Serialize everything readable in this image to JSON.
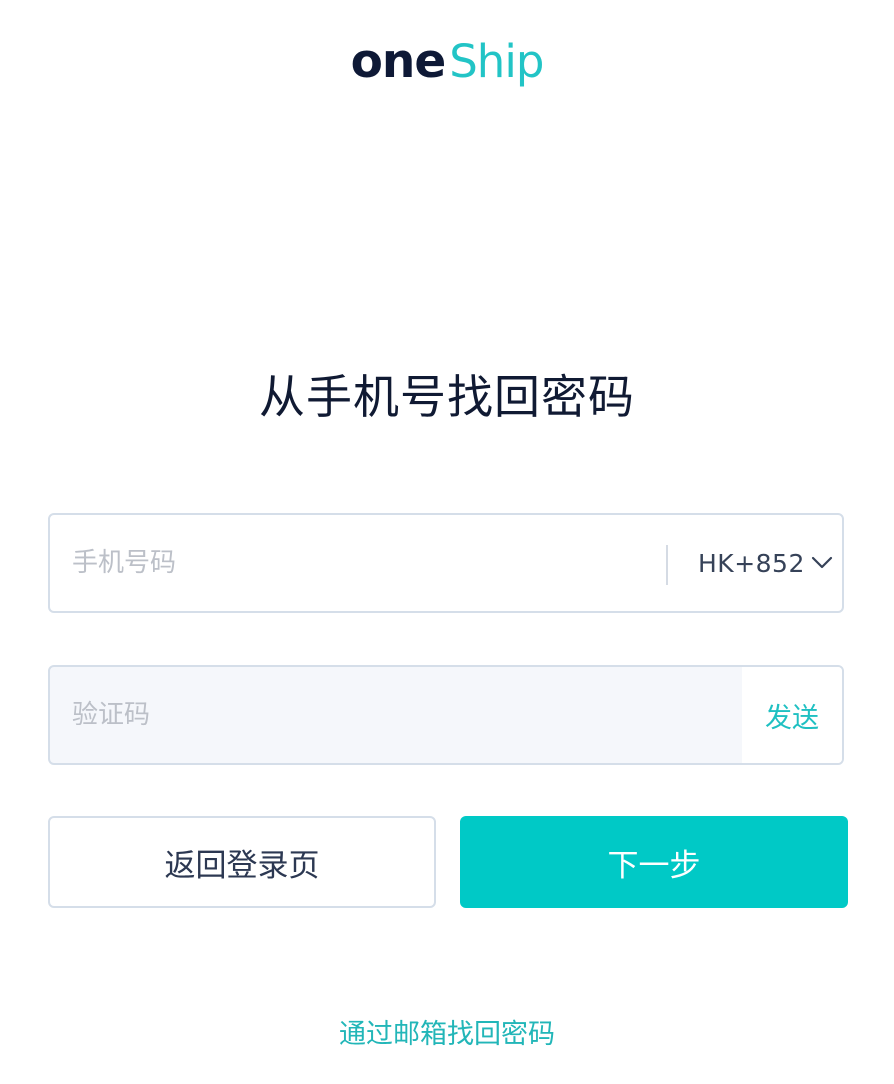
{
  "logo": {
    "part1": "one",
    "part2": "Ship",
    "colors": {
      "primary": "#0e1936",
      "accent": "#22c4c6"
    }
  },
  "title": "从手机号找回密码",
  "phone": {
    "placeholder": "手机号码",
    "value": "",
    "country_code": "HK+852",
    "dropdown_icon": "chevron-down-icon"
  },
  "verification": {
    "placeholder": "验证码",
    "value": "",
    "send_label": "发送"
  },
  "buttons": {
    "back_label": "返回登录页",
    "next_label": "下一步"
  },
  "email_link": "通过邮箱找回密码",
  "colors": {
    "brand": "#00c9c6",
    "text_dark": "#101a33",
    "border": "#d5dee9",
    "placeholder": "#bcc0c8"
  }
}
